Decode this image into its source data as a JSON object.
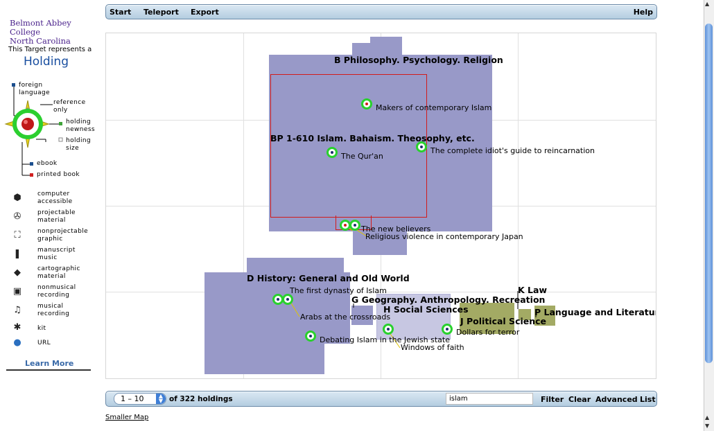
{
  "sidebar": {
    "college_line1": "Belmont Abbey College",
    "college_line2": "North Carolina",
    "target_caption": "This Target represents a",
    "target_type": "Holding",
    "legend": {
      "foreign_language": "foreign language",
      "reference_only": "reference only",
      "holding_newness": "holding newness",
      "holding_size": "holding size",
      "ebook": "ebook",
      "printed_book": "printed book"
    },
    "formats": [
      {
        "label": "computer accessible",
        "icon": "computer-icon",
        "glyph": "⬢"
      },
      {
        "label": "projectable material",
        "icon": "film-projector-icon",
        "glyph": "✇"
      },
      {
        "label": "nonprojectable graphic",
        "icon": "graphic-icon",
        "glyph": "⛶"
      },
      {
        "label": "manuscript music",
        "icon": "manuscript-icon",
        "glyph": "❚"
      },
      {
        "label": "cartographic material",
        "icon": "map-icon",
        "glyph": "◆"
      },
      {
        "label": "nonmusical recording",
        "icon": "recording-icon",
        "glyph": "▣"
      },
      {
        "label": "musical recording",
        "icon": "music-note-icon",
        "glyph": "♫"
      },
      {
        "label": "kit",
        "icon": "kit-icon",
        "glyph": "✱"
      },
      {
        "label": "URL",
        "icon": "globe-icon",
        "glyph": "●"
      }
    ],
    "learn_more": "Learn More"
  },
  "toolbar_top": {
    "start": "Start",
    "teleport": "Teleport",
    "export": "Export",
    "help": "Help"
  },
  "map": {
    "regions": {
      "b": "B Philosophy. Psychology. Religion",
      "bp": "BP 1-610 Islam. Bahaism. Theosophy, etc.",
      "d": "D History: General and Old World",
      "g": "G Geography. Anthropology. Recreation",
      "h": "H Social Sciences",
      "j": "J Political Science",
      "k": "K Law",
      "p": "P Language and Literature"
    },
    "items": {
      "makers": "Makers of contemporary Islam",
      "idiot": "The complete idiot's guide to reincarnation",
      "quran": "The Qur'an",
      "believers": "The new believers",
      "violence": "Religious violence in contemporary Japan",
      "dynasty": "The first dynasty of Islam",
      "arabs": "Arabs at the crossroads",
      "debating": "Debating Islam in the Jewish state",
      "windows": "Windows of faith",
      "dollars": "Dollars for terror"
    }
  },
  "toolbar_bottom": {
    "range": "1 – 10",
    "count_text": "of 322 holdings",
    "search_value": "islam",
    "filter": "Filter",
    "clear": "Clear",
    "advanced": "Advanced",
    "list": "List"
  },
  "smaller_map": "Smaller Map",
  "colors": {
    "class_region": "#9899c8",
    "law_region": "#a3aa64",
    "marker_ring": "#29d12d",
    "target_red": "#d21a1a"
  }
}
